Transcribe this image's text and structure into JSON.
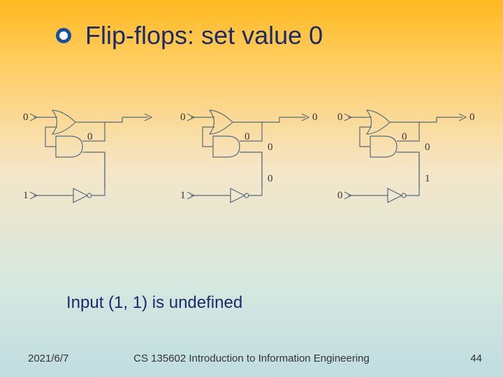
{
  "title": "Flip-flops: set value 0",
  "note": "Input (1, 1) is undefined",
  "footer": {
    "date": "2021/6/7",
    "course": "CS 135602 Introduction to Information Engineering",
    "page": "44"
  },
  "circuits": [
    {
      "top_in": "0",
      "bottom_in": "1",
      "or_out": "",
      "and_in_right": "0",
      "and_out": "",
      "feedback": ""
    },
    {
      "top_in": "0",
      "bottom_in": "1",
      "or_out": "0",
      "and_in_right": "0",
      "and_out": "0",
      "feedback": "0"
    },
    {
      "top_in": "0",
      "bottom_in": "0",
      "or_out": "0",
      "and_in_right": "0",
      "and_out": "0",
      "feedback": "1"
    }
  ]
}
